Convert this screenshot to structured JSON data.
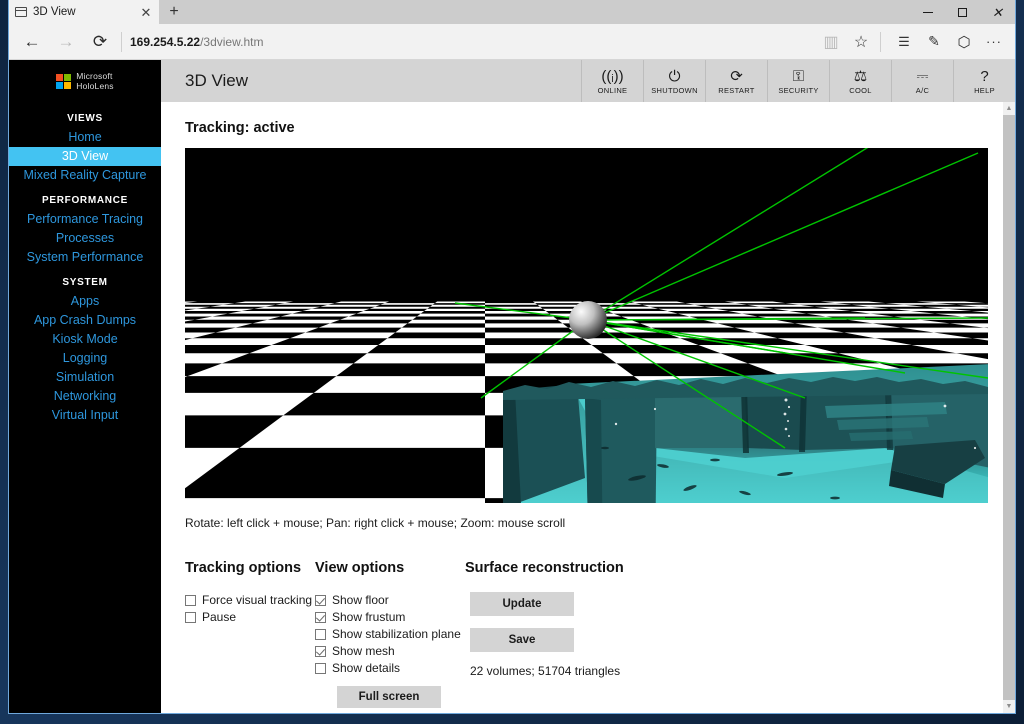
{
  "browser": {
    "tab": {
      "title": "3D View",
      "close_label": "✕",
      "favicon": "window-icon"
    },
    "newtab_label": "+",
    "window_controls": {
      "minimize": "–",
      "maximize": "□",
      "close": "✕"
    },
    "nav": {
      "back": "←",
      "forward": "→",
      "refresh": "⟳"
    },
    "address": {
      "host": "169.254.5.22",
      "path": "/3dview.htm"
    },
    "toolbar_icons": [
      {
        "name": "reading-view-icon",
        "glyph": "▥"
      },
      {
        "name": "favorites-star-icon",
        "glyph": "☆"
      },
      {
        "name": "hub-icon",
        "glyph": "☰"
      },
      {
        "name": "web-note-icon",
        "glyph": "✎"
      },
      {
        "name": "share-icon",
        "glyph": "⬡"
      },
      {
        "name": "settings-more-icon",
        "glyph": "···"
      }
    ]
  },
  "sidebar": {
    "brand": {
      "line1": "Microsoft",
      "line2": "HoloLens"
    },
    "logo_colors": [
      "#f25022",
      "#7fba00",
      "#00a4ef",
      "#ffb900"
    ],
    "groups": [
      {
        "title": "VIEWS",
        "items": [
          {
            "label": "Home",
            "active": false
          },
          {
            "label": "3D View",
            "active": true
          },
          {
            "label": "Mixed Reality Capture",
            "active": false
          }
        ]
      },
      {
        "title": "PERFORMANCE",
        "items": [
          {
            "label": "Performance Tracing",
            "active": false
          },
          {
            "label": "Processes",
            "active": false
          },
          {
            "label": "System Performance",
            "active": false
          }
        ]
      },
      {
        "title": "SYSTEM",
        "items": [
          {
            "label": "Apps",
            "active": false
          },
          {
            "label": "App Crash Dumps",
            "active": false
          },
          {
            "label": "Kiosk Mode",
            "active": false
          },
          {
            "label": "Logging",
            "active": false
          },
          {
            "label": "Simulation",
            "active": false
          },
          {
            "label": "Networking",
            "active": false
          },
          {
            "label": "Virtual Input",
            "active": false
          }
        ]
      }
    ],
    "accent": "#43c3f2",
    "link_color": "#2e97dd"
  },
  "app": {
    "title": "3D View",
    "status_icons": [
      {
        "name": "online-icon",
        "glyph": "((ᵢ))",
        "label": "ONLINE"
      },
      {
        "name": "shutdown-icon",
        "glyph": "⏻",
        "label": "SHUTDOWN"
      },
      {
        "name": "restart-icon",
        "glyph": "⟳",
        "label": "RESTART"
      },
      {
        "name": "security-lock-icon",
        "glyph": "⚿",
        "label": "SECURITY"
      },
      {
        "name": "temperature-icon",
        "glyph": "⚖",
        "label": "COOL"
      },
      {
        "name": "ac-power-icon",
        "glyph": "⎓",
        "label": "A/C"
      },
      {
        "name": "help-icon",
        "glyph": "?",
        "label": "HELP"
      }
    ]
  },
  "main": {
    "tracking_status": "Tracking: active",
    "viewport_hint": "Rotate: left click + mouse; Pan: right click + mouse; Zoom: mouse scroll",
    "tracking_options": {
      "heading": "Tracking options",
      "items": [
        {
          "label": "Force visual tracking",
          "checked": false
        },
        {
          "label": "Pause",
          "checked": false
        }
      ]
    },
    "view_options": {
      "heading": "View options",
      "items": [
        {
          "label": "Show floor",
          "checked": true
        },
        {
          "label": "Show frustum",
          "checked": true
        },
        {
          "label": "Show stabilization plane",
          "checked": false
        },
        {
          "label": "Show mesh",
          "checked": true
        },
        {
          "label": "Show details",
          "checked": false
        }
      ],
      "fullscreen_label": "Full screen"
    },
    "surface_reconstruction": {
      "heading": "Surface reconstruction",
      "update_label": "Update",
      "save_label": "Save",
      "stats": "22 volumes; 51704 triangles"
    }
  },
  "scene": {
    "background": "#000000",
    "floor_light": "#ffffff",
    "floor_dark": "#000000",
    "mesh_color": "#3fc6c6",
    "mesh_shadow": "#1d4a4d",
    "frustum_color": "#00c000",
    "camera_sphere": "#c9c9c9"
  },
  "scrollbar": {
    "up_arrow": "▲",
    "down_arrow": "▼"
  }
}
